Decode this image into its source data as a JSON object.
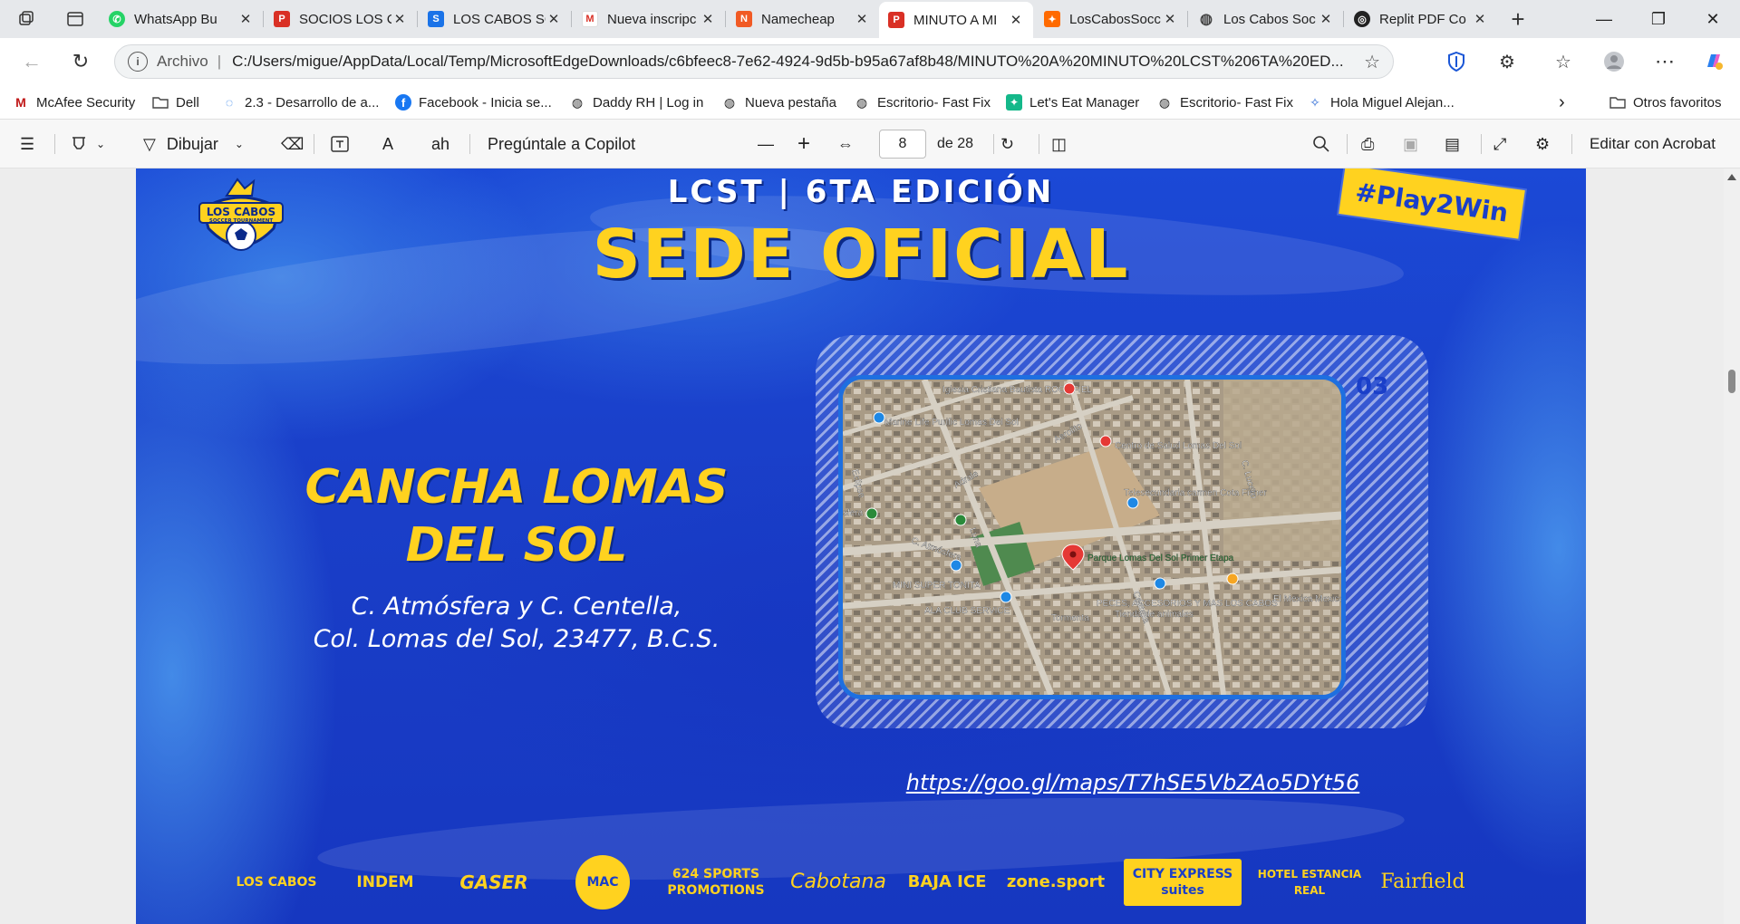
{
  "browser": {
    "tabs": [
      {
        "title": "WhatsApp Bu",
        "favicon": "whatsapp-icon",
        "active": false
      },
      {
        "title": "SOCIOS LOS C",
        "favicon": "pdf-icon",
        "active": false
      },
      {
        "title": "LOS CABOS SC",
        "favicon": "s-app-icon",
        "active": false
      },
      {
        "title": "Nueva inscripc",
        "favicon": "gmail-icon",
        "active": false
      },
      {
        "title": "Namecheap",
        "favicon": "namecheap-icon",
        "active": false
      },
      {
        "title": "MINUTO A MI",
        "favicon": "pdf-icon",
        "active": true
      },
      {
        "title": "LosCabosSocc",
        "favicon": "app-icon",
        "active": false
      },
      {
        "title": "Los Cabos Soc",
        "favicon": "globe-icon",
        "active": false
      },
      {
        "title": "Replit PDF Co",
        "favicon": "replit-icon",
        "active": false
      }
    ],
    "address": {
      "scheme_label": "Archivo",
      "url": "C:/Users/migue/AppData/Local/Temp/MicrosoftEdgeDownloads/c6bfeec8-7e62-4924-9d5b-b95a67af8b48/MINUTO%20A%20MINUTO%20LCST%206TA%20ED..."
    },
    "favorites": [
      {
        "label": "McAfee Security",
        "icon": "mcafee-icon"
      },
      {
        "label": "Dell",
        "icon": "folder-icon"
      },
      {
        "label": "2.3 - Desarrollo de a...",
        "icon": "loading-icon"
      },
      {
        "label": "Facebook - Inicia se...",
        "icon": "facebook-icon"
      },
      {
        "label": "Daddy RH | Log in",
        "icon": "globe-icon"
      },
      {
        "label": "Nueva pestaña",
        "icon": "globe-icon"
      },
      {
        "label": "Escritorio- Fast Fix",
        "icon": "globe-icon"
      },
      {
        "label": "Let's Eat Manager",
        "icon": "app-icon"
      },
      {
        "label": "Escritorio- Fast Fix",
        "icon": "globe-icon"
      },
      {
        "label": "Hola Miguel Alejan...",
        "icon": "app-icon"
      }
    ],
    "other_favorites": "Otros favoritos"
  },
  "pdf_toolbar": {
    "draw_label": "Dibujar",
    "copilot_label": "Pregúntale a Copilot",
    "page_current": "8",
    "page_total": "de 28",
    "edit_acrobat": "Editar con Acrobat"
  },
  "slide": {
    "logo_text": "LOS CABOS",
    "logo_sub": "SOCCER TOURNAMENT",
    "header": "LCST | 6TA EDICIÓN",
    "title": "SEDE OFICIAL",
    "hashtag": "#Play2Win",
    "page_badge": "03",
    "venue_line1": "CANCHA LOMAS",
    "venue_line2": "DEL SOL",
    "address_line1": "C. Atmósfera y C. Centella,",
    "address_line2": "Col. Lomas del Sol, 23477, B.C.S.",
    "map_link": "https://goo.gl/maps/T7hSE5VbZAo5DYt56",
    "map_labels": [
      "Iglesia Cristiana Bautista ROCA FIEL",
      "Marine Life Purific Lomas Del Sol",
      "Centro de Salud Lomas Del Sol",
      "Telesecundaria carmen Cota Fisher",
      "Parque Lomas Del Sol Primer Etapa",
      "MINI SUPER TONITA",
      "ALA CLUB SERVICE",
      "PECES, ACCESORIOS Y MAS LOS CABOS",
      "El Mexica Mexicana",
      "Aerolito",
      "Adrale",
      "C. Atmósfera",
      "Luna",
      "Tormenta",
      "C. Lucero",
      "Centella",
      "Eclipse",
      "Tienda de animales",
      "sfera"
    ],
    "sponsors": [
      "LOS CABOS",
      "INDEM",
      "GASER",
      "MAC",
      "624 SPORTS PROMOTIONS",
      "Cabotana",
      "BAJA ICE",
      "zone.sport",
      "CITY EXPRESS suites",
      "HOTEL ESTANCIA REAL",
      "Fairfield"
    ]
  },
  "colors": {
    "slide_blue": "#1a3fc9",
    "accent_yellow": "#ffd21f",
    "link_white": "#ffffff"
  }
}
